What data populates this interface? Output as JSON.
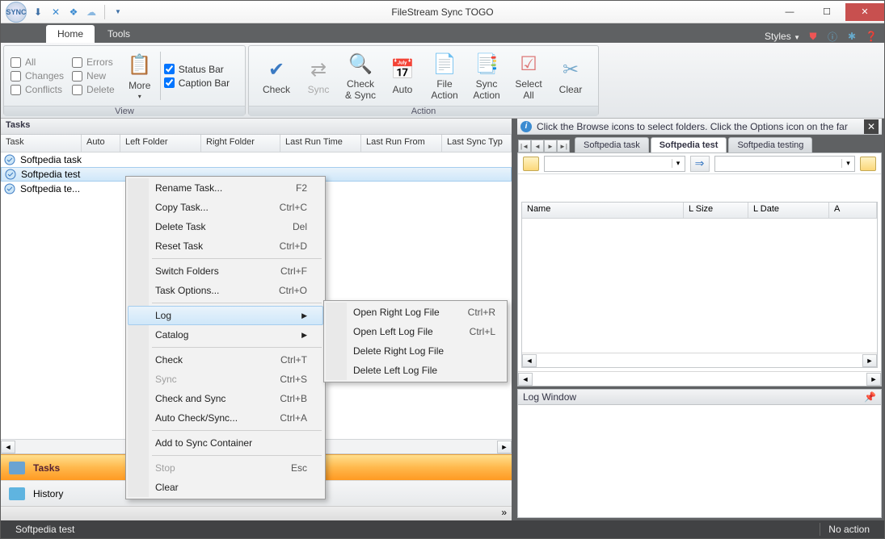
{
  "title": "FileStream Sync TOGO",
  "styles_label": "Styles",
  "ribbon_tabs": {
    "home": "Home",
    "tools": "Tools"
  },
  "view_group": {
    "label": "View",
    "all": "All",
    "errors": "Errors",
    "changes": "Changes",
    "new": "New",
    "conflicts": "Conflicts",
    "delete": "Delete",
    "more": "More",
    "status_bar": "Status Bar",
    "caption_bar": "Caption Bar"
  },
  "action_group": {
    "label": "Action",
    "check": "Check",
    "sync": "Sync",
    "check_sync": "Check\n& Sync",
    "auto": "Auto",
    "file_action": "File\nAction",
    "sync_action": "Sync\nAction",
    "select_all": "Select\nAll",
    "clear": "Clear"
  },
  "tasks_panel": {
    "header": "Tasks",
    "cols": {
      "task": "Task",
      "auto": "Auto",
      "left": "Left Folder",
      "right": "Right Folder",
      "last_run_time": "Last Run Time",
      "last_run_from": "Last Run From",
      "last_sync": "Last Sync Typ"
    },
    "rows": [
      {
        "name": "Softpedia task"
      },
      {
        "name": "Softpedia test"
      },
      {
        "name": "Softpedia te..."
      }
    ],
    "nav": {
      "tasks": "Tasks",
      "history": "History"
    }
  },
  "ctx_menu": {
    "rename": "Rename Task...",
    "rename_sc": "F2",
    "copy": "Copy Task...",
    "copy_sc": "Ctrl+C",
    "delete": "Delete Task",
    "delete_sc": "Del",
    "reset": "Reset Task",
    "reset_sc": "Ctrl+D",
    "switch": "Switch Folders",
    "switch_sc": "Ctrl+F",
    "options": "Task Options...",
    "options_sc": "Ctrl+O",
    "log": "Log",
    "catalog": "Catalog",
    "check": "Check",
    "check_sc": "Ctrl+T",
    "sync": "Sync",
    "sync_sc": "Ctrl+S",
    "checksync": "Check and Sync",
    "checksync_sc": "Ctrl+B",
    "autocs": "Auto Check/Sync...",
    "autocs_sc": "Ctrl+A",
    "addcont": "Add to Sync Container",
    "stop": "Stop",
    "stop_sc": "Esc",
    "clear": "Clear"
  },
  "ctx_sub": {
    "open_right": "Open Right Log File",
    "open_right_sc": "Ctrl+R",
    "open_left": "Open Left Log File",
    "open_left_sc": "Ctrl+L",
    "del_right": "Delete Right Log File",
    "del_left": "Delete Left Log File"
  },
  "right": {
    "info": "Click the Browse icons to select folders. Click the Options icon on the far",
    "tabs": [
      "Softpedia task",
      "Softpedia test",
      "Softpedia testing"
    ],
    "file_cols": {
      "name": "Name",
      "lsize": "L Size",
      "ldate": "L Date",
      "a": "A"
    },
    "log": "Log Window"
  },
  "status": {
    "left": "Softpedia test",
    "right": "No action"
  }
}
